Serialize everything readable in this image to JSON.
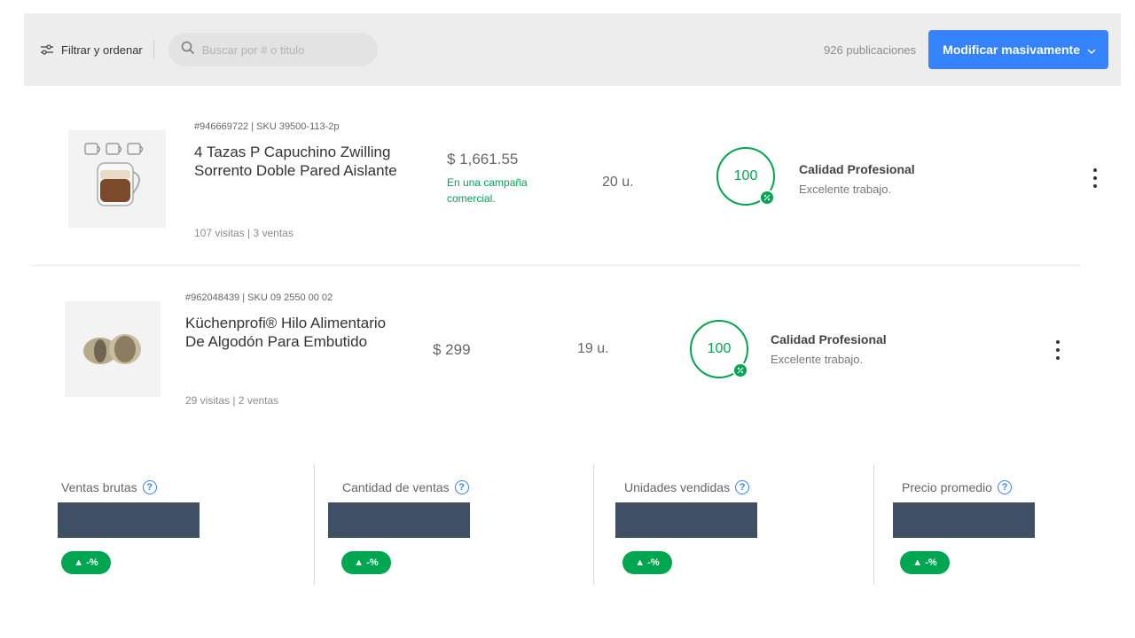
{
  "toolbar": {
    "filter_label": "Filtrar y ordenar",
    "search_placeholder": "Buscar por # o titulo",
    "publication_count": "926 publicaciones",
    "bulk_edit_label": "Modificar masivamente",
    "accent_color": "#3483fa"
  },
  "listings": [
    {
      "meta": "#946669722 | SKU 39500-113-2p",
      "title": "4 Tazas P Capuchino Zwilling Sorrento Doble Pared Aislante",
      "stats": "107 visitas | 3 ventas",
      "price": "$ 1,661.55",
      "campaign": "En una campaña comercial.",
      "stock": "20 u.",
      "quality_score": "100",
      "quality_title": "Calidad Profesional",
      "quality_subtitle": "Excelente trabajo."
    },
    {
      "meta": "#962048439 | SKU 09 2550 00 02",
      "title": "Küchenprofi® Hilo Alimentario De Algodón Para Embutido",
      "stats": "29 visitas | 2 ventas",
      "price": "$ 299",
      "stock": "19 u.",
      "quality_score": "100",
      "quality_title": "Calidad Profesional",
      "quality_subtitle": "Excelente trabajo."
    }
  ],
  "metrics": [
    {
      "label": "Ventas brutas",
      "delta": "▲ -%"
    },
    {
      "label": "Cantidad de ventas",
      "delta": "▲ -%"
    },
    {
      "label": "Unidades vendidas",
      "delta": "▲ -%"
    },
    {
      "label": "Precio promedio",
      "delta": "▲ -%"
    }
  ],
  "colors": {
    "positive": "#00a650",
    "redacted_value": "#3f4f66"
  }
}
